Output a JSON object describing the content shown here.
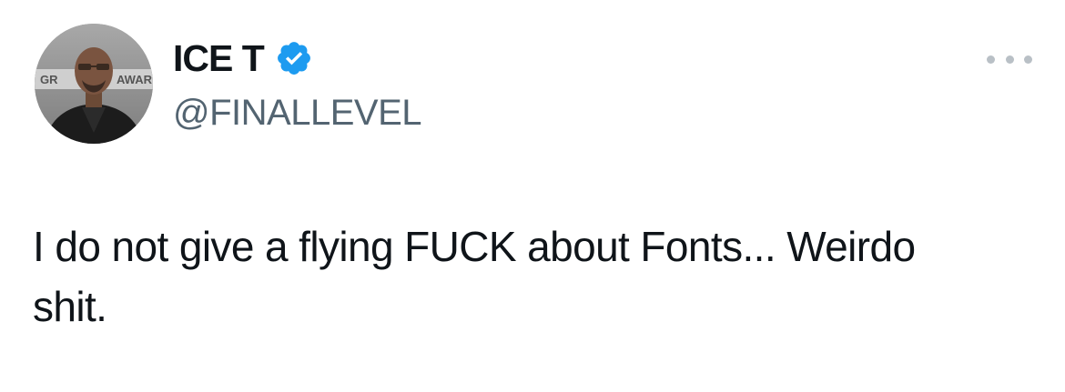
{
  "tweet": {
    "author": {
      "display_name": "ICE T",
      "handle": "@FINALLEVEL",
      "verified": true,
      "avatar": {
        "icon": "avatar-photo",
        "backdrop_text_left": "GR",
        "backdrop_text_right": "AWAR"
      }
    },
    "more_icon": "more-options-icon",
    "text": "I do not give a flying FUCK about Fonts... Weirdo\nshit."
  },
  "colors": {
    "name": "#0f1419",
    "handle": "#536471",
    "verified_badge": "#1d9bf0",
    "more_dots": "#b9c0c6",
    "background": "#ffffff"
  }
}
